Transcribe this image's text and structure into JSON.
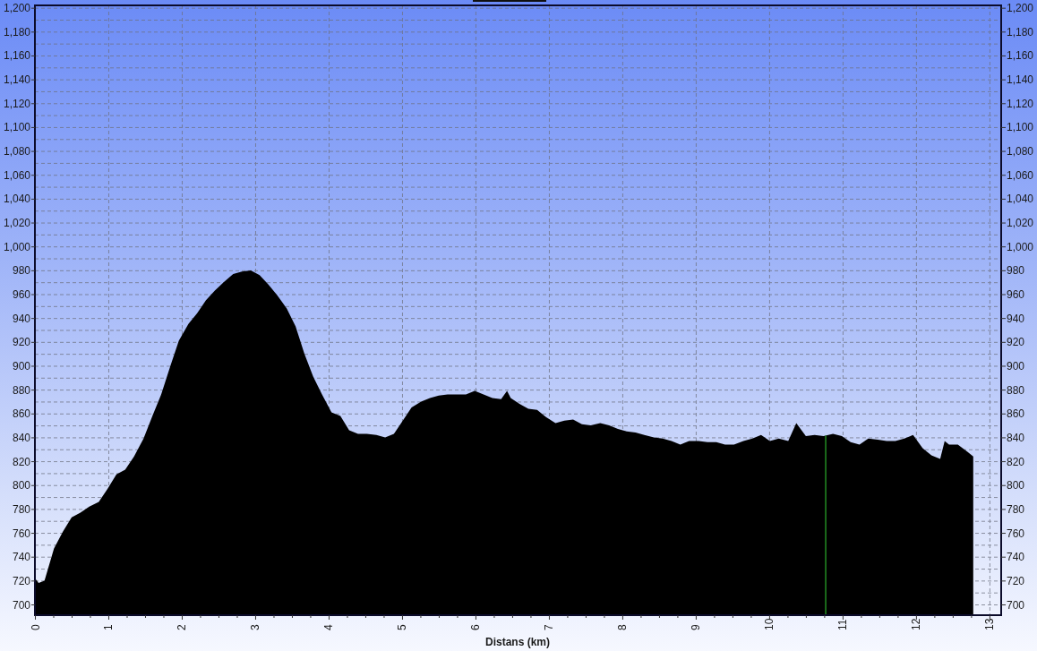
{
  "elevation_profile": {
    "chart_data": {
      "type": "area",
      "xlabel": "Distans (km)",
      "xlim": [
        0,
        13.16
      ],
      "ylim": [
        691,
        1202
      ],
      "grid": true,
      "xticks": [
        0,
        1,
        2,
        3,
        4,
        5,
        6,
        7,
        8,
        9,
        10,
        11,
        12,
        13
      ],
      "yticks": [
        {
          "value": 700,
          "label": "700"
        },
        {
          "value": 720,
          "label": "720"
        },
        {
          "value": 740,
          "label": "740"
        },
        {
          "value": 760,
          "label": "760"
        },
        {
          "value": 780,
          "label": "780"
        },
        {
          "value": 800,
          "label": "800"
        },
        {
          "value": 820,
          "label": "820"
        },
        {
          "value": 840,
          "label": "840"
        },
        {
          "value": 860,
          "label": "860"
        },
        {
          "value": 880,
          "label": "880"
        },
        {
          "value": 900,
          "label": "900"
        },
        {
          "value": 920,
          "label": "920"
        },
        {
          "value": 940,
          "label": "940"
        },
        {
          "value": 960,
          "label": "960"
        },
        {
          "value": 980,
          "label": "980"
        },
        {
          "value": 1000,
          "label": "1,000"
        },
        {
          "value": 1020,
          "label": "1,020"
        },
        {
          "value": 1040,
          "label": "1,040"
        },
        {
          "value": 1060,
          "label": "1,060"
        },
        {
          "value": 1080,
          "label": "1,080"
        },
        {
          "value": 1100,
          "label": "1,100"
        },
        {
          "value": 1120,
          "label": "1,120"
        },
        {
          "value": 1140,
          "label": "1,140"
        },
        {
          "value": 1160,
          "label": "1,160"
        },
        {
          "value": 1180,
          "label": "1,180"
        },
        {
          "value": 1200,
          "label": "1,200"
        }
      ],
      "x": [
        0,
        0.05,
        0.13,
        0.26,
        0.38,
        0.5,
        0.62,
        0.74,
        0.87,
        0.99,
        1.11,
        1.23,
        1.35,
        1.48,
        1.6,
        1.72,
        1.84,
        1.96,
        2.09,
        2.21,
        2.33,
        2.45,
        2.57,
        2.7,
        2.82,
        2.94,
        3.06,
        3.18,
        3.3,
        3.43,
        3.55,
        3.67,
        3.79,
        3.91,
        4.04,
        4.16,
        4.28,
        4.4,
        4.52,
        4.65,
        4.77,
        4.89,
        5.01,
        5.13,
        5.26,
        5.38,
        5.5,
        5.62,
        5.74,
        5.87,
        5.99,
        6.11,
        6.23,
        6.35,
        6.43,
        6.48,
        6.6,
        6.72,
        6.84,
        6.96,
        7.09,
        7.21,
        7.33,
        7.45,
        7.57,
        7.7,
        7.82,
        7.94,
        8.06,
        8.18,
        8.3,
        8.43,
        8.55,
        8.67,
        8.79,
        8.91,
        9.04,
        9.16,
        9.28,
        9.4,
        9.52,
        9.65,
        9.77,
        9.89,
        10.01,
        10.13,
        10.26,
        10.37,
        10.5,
        10.62,
        10.74,
        10.87,
        10.99,
        11.11,
        11.23,
        11.35,
        11.48,
        11.6,
        11.72,
        11.84,
        11.96,
        12.09,
        12.21,
        12.33,
        12.39,
        12.45,
        12.57,
        12.7,
        12.78
      ],
      "series": [
        {
          "color": "#000000",
          "values": [
            722,
            718,
            720,
            747,
            761,
            773,
            777,
            782,
            786,
            797,
            809,
            813,
            824,
            839,
            858,
            876,
            899,
            921,
            935,
            944,
            955,
            963,
            970,
            977,
            979,
            980,
            976,
            968,
            959,
            948,
            933,
            910,
            891,
            876,
            861,
            858,
            846,
            843,
            843,
            842,
            840,
            843,
            854,
            865,
            870,
            873,
            875,
            876,
            876,
            876,
            879,
            876,
            873,
            872,
            879,
            873,
            868,
            864,
            863,
            857,
            852,
            854,
            855,
            851,
            850,
            852,
            850,
            847,
            845,
            844,
            842,
            840,
            839,
            837,
            834,
            837,
            837,
            836,
            836,
            834,
            834,
            837,
            839,
            842,
            837,
            839,
            837,
            852,
            841,
            842,
            841,
            843,
            841,
            836,
            834,
            839,
            838,
            837,
            837,
            839,
            842,
            831,
            825,
            822,
            837,
            834,
            834,
            828,
            824
          ]
        }
      ],
      "ref_lines": [
        {
          "axis": "x",
          "value": 10.77,
          "color": "#228b22"
        }
      ]
    },
    "right_axis": {
      "tick_labels": [
        "1,200",
        "1,180",
        "1,160",
        "1,140",
        "1,120",
        "1,100",
        "1,080",
        "1,060",
        "1,040",
        "1,020",
        "1,000",
        "980",
        "960",
        "940",
        "920",
        "900",
        "880",
        "860",
        "840",
        "820",
        "800",
        "780",
        "760",
        "740",
        "720",
        "700"
      ]
    }
  }
}
